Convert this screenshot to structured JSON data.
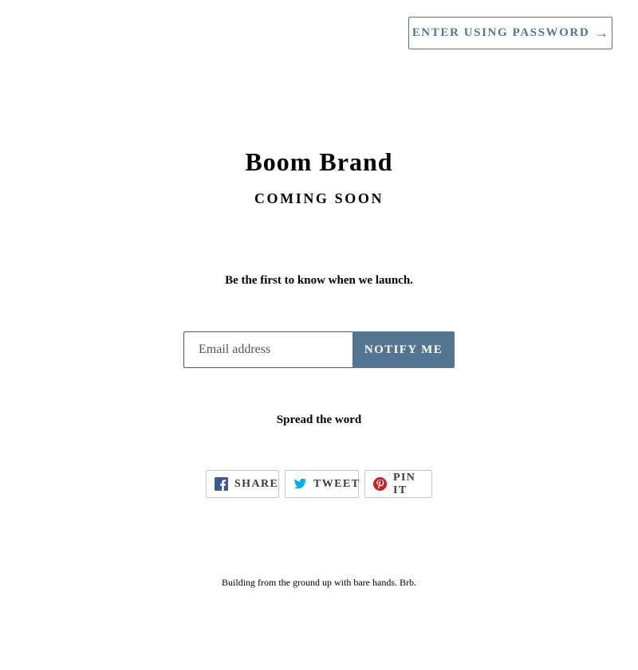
{
  "header": {
    "enter_password_label": "ENTER USING PASSWORD",
    "enter_password_arrow": "→"
  },
  "brand": {
    "title": "Boom Brand",
    "subtitle": "COMING SOON"
  },
  "signup": {
    "heading": "Be the first to know when we launch.",
    "email_placeholder": "Email address",
    "email_value": "",
    "submit_label": "NOTIFY ME"
  },
  "share": {
    "heading": "Spread the word",
    "buttons": [
      {
        "label": "SHARE",
        "icon": "facebook-icon"
      },
      {
        "label": "TWEET",
        "icon": "twitter-icon"
      },
      {
        "label": "PIN IT",
        "icon": "pinterest-icon"
      }
    ]
  },
  "footer": {
    "text": "Building from the ground up with bare hands. Brb."
  },
  "colors": {
    "accent": "#537591",
    "facebook": "#3b5998",
    "twitter": "#00aced",
    "pinterest": "#cb2027"
  }
}
